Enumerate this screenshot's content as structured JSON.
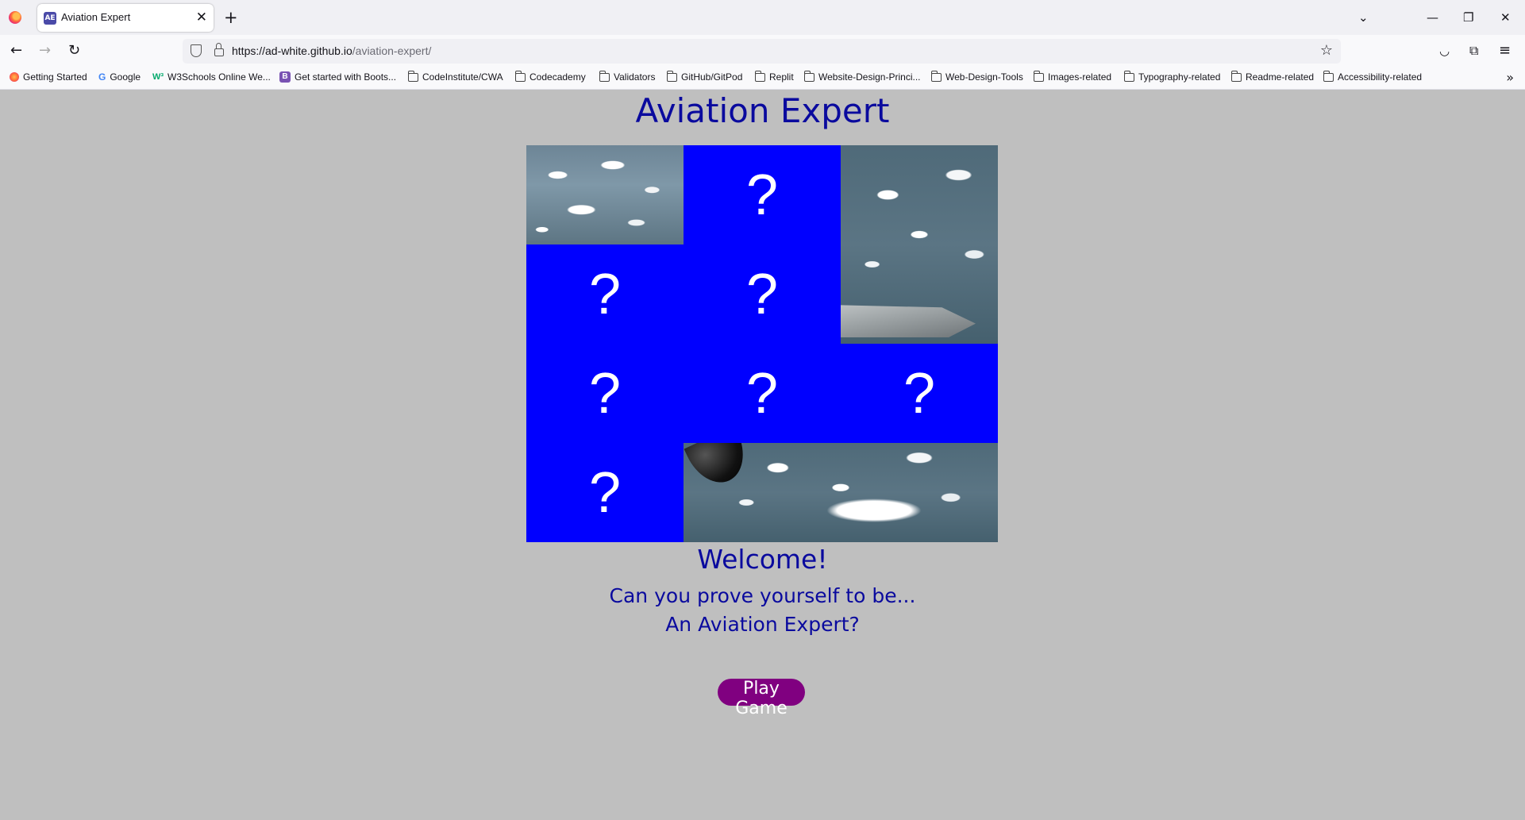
{
  "browser": {
    "tab_title": "Aviation Expert",
    "tab_favicon_text": "AE",
    "url_host": "https://ad-white.github.io",
    "url_path": "/aviation-expert/",
    "bookmarks": [
      "Getting Started",
      "Google",
      "W3Schools Online We...",
      "Get started with Boots...",
      "CodeInstitute/CWA",
      "Codecademy",
      "Validators",
      "GitHub/GitPod",
      "Replit",
      "Website-Design-Princi...",
      "Web-Design-Tools",
      "Images-related",
      "Typography-related",
      "Readme-related",
      "Accessibility-related"
    ]
  },
  "page": {
    "title": "Aviation Expert",
    "tile_hidden_symbol": "?",
    "welcome": "Welcome!",
    "tagline_line1": "Can you prove yourself to be...",
    "tagline_line2": "An Aviation Expert?",
    "play_button": "Play Game"
  },
  "colors": {
    "page_background": "#bfbfbf",
    "text_blue": "#0a0a9e",
    "tile_blue": "#0000ff",
    "button_purple": "#800080"
  }
}
